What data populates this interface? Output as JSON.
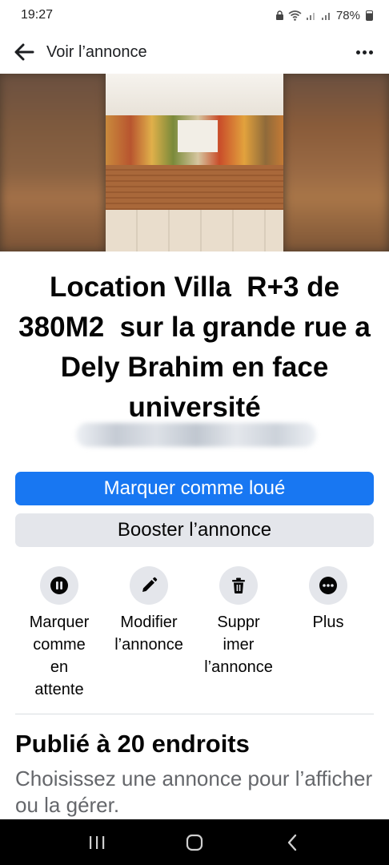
{
  "status_bar": {
    "time": "19:27",
    "battery": "78%",
    "icons": [
      "lock-icon",
      "wifi-icon",
      "signal-icon",
      "signal-icon",
      "battery-icon"
    ]
  },
  "header": {
    "title": "Voir l’annonce",
    "back_icon": "arrow-left-icon",
    "more_icon": "more-horizontal-icon"
  },
  "listing": {
    "title": "Location Villa  R+3 de 380M2  sur la grande rue a Dely Brahim en face  université"
  },
  "buttons": {
    "mark_rented": "Marquer comme loué",
    "boost": "Booster l’annonce"
  },
  "actions": [
    {
      "label": "Marquer\ncomme\nen\nattente",
      "icon": "pause-icon"
    },
    {
      "label": "Modifier\nl’annonce",
      "icon": "pencil-icon"
    },
    {
      "label": "Suppr\nimer\nl’annonce",
      "icon": "trash-icon"
    },
    {
      "label": "Plus",
      "icon": "more-horizontal-icon"
    }
  ],
  "published": {
    "title": "Publié à 20 endroits",
    "subtitle": "Choisissez une annonce pour l’afficher ou la gérer."
  },
  "nav": {
    "icons": [
      "recent-apps-icon",
      "home-icon",
      "back-chevron-icon"
    ]
  },
  "colors": {
    "primary": "#1877f2",
    "secondary_bg": "#e4e6eb",
    "muted_text": "#65676b"
  }
}
